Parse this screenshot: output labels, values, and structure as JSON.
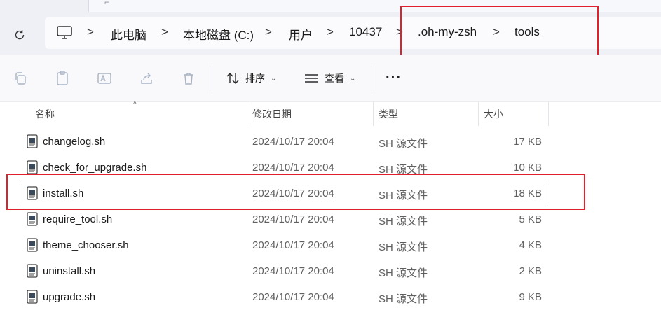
{
  "address_bar": {
    "crumbs": [
      "此电脑",
      "本地磁盘 (C:)",
      "用户",
      "10437",
      ".oh-my-zsh",
      "tools"
    ],
    "separator": ">"
  },
  "toolbar": {
    "sort_label": "排序",
    "view_label": "查看",
    "more_label": "···"
  },
  "columns": {
    "name": "名称",
    "modified": "修改日期",
    "type": "类型",
    "size": "大小"
  },
  "files": [
    {
      "name": "changelog.sh",
      "modified": "2024/10/17 20:04",
      "type": "SH 源文件",
      "size": "17 KB"
    },
    {
      "name": "check_for_upgrade.sh",
      "modified": "2024/10/17 20:04",
      "type": "SH 源文件",
      "size": "10 KB"
    },
    {
      "name": "install.sh",
      "modified": "2024/10/17 20:04",
      "type": "SH 源文件",
      "size": "18 KB"
    },
    {
      "name": "require_tool.sh",
      "modified": "2024/10/17 20:04",
      "type": "SH 源文件",
      "size": "5 KB"
    },
    {
      "name": "theme_chooser.sh",
      "modified": "2024/10/17 20:04",
      "type": "SH 源文件",
      "size": "4 KB"
    },
    {
      "name": "uninstall.sh",
      "modified": "2024/10/17 20:04",
      "type": "SH 源文件",
      "size": "2 KB"
    },
    {
      "name": "upgrade.sh",
      "modified": "2024/10/17 20:04",
      "type": "SH 源文件",
      "size": "9 KB"
    }
  ],
  "colors": {
    "annotation_red": "#e0202a",
    "chrome_bg": "#eef0f6"
  }
}
